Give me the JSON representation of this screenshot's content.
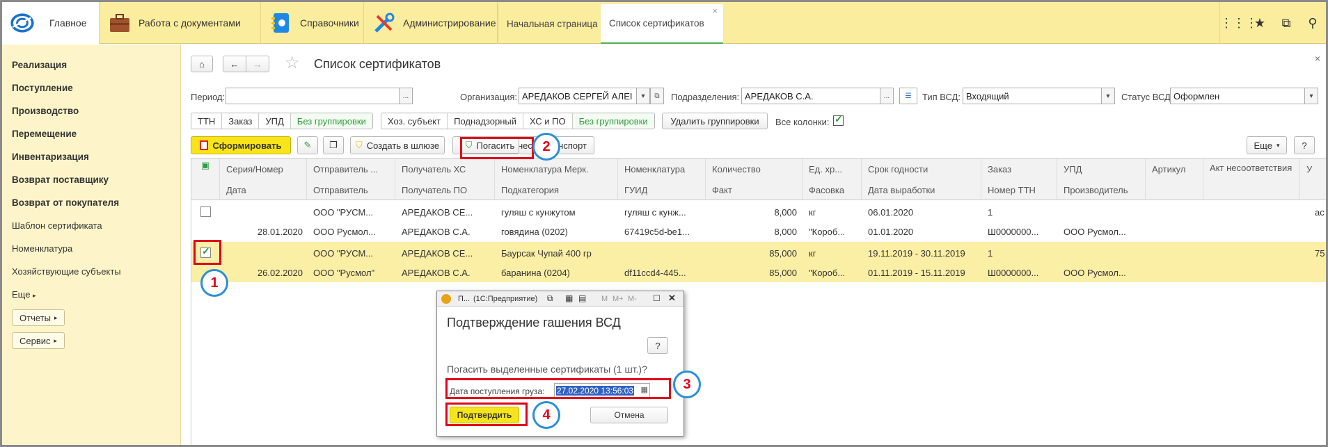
{
  "topbar": {
    "home_label": "Главное",
    "sections": [
      "Работа с документами",
      "Справочники",
      "Администрирование"
    ],
    "tabs": [
      {
        "label": "Начальная страница"
      },
      {
        "label": "Список сертификатов"
      }
    ],
    "tab_close": "×",
    "icons": [
      "apps-grid-icon",
      "star-icon",
      "history-icon",
      "search-icon"
    ]
  },
  "sidebar": {
    "bold_items": [
      "Реализация",
      "Поступление",
      "Производство",
      "Перемещение",
      "Инвентаризация",
      "Возврат поставщику",
      "Возврат от покупателя"
    ],
    "items": [
      "Шаблон сертификата",
      "Номенклатура",
      "Хозяйствующие субъекты"
    ],
    "more": "Еще",
    "reports": "Отчеты",
    "service": "Сервис"
  },
  "main": {
    "title": "Список сертификатов",
    "close": "×",
    "filters": {
      "period_label": "Период:",
      "period_value": "",
      "org_label": "Организация:",
      "org_value": "АРЕДАКОВ СЕРГЕЙ АЛЕІ",
      "dept_label": "Подразделения:",
      "dept_value": "АРЕДАКОВ С.А.",
      "vsd_type_label": "Тип ВСД:",
      "vsd_type_value": "Входящий",
      "vsd_status_label": "Статус ВСД:",
      "vsd_status_value": "Оформлен"
    },
    "grouping1": [
      "ТТН",
      "Заказ",
      "УПД",
      "Без группировки"
    ],
    "grouping2": [
      "Хоз. субъект",
      "Поднадзорный",
      "ХС и ПО",
      "Без группировки"
    ],
    "remove_groupings": "Удалить группировки",
    "all_columns_label": "Все колонки:",
    "toolbar": {
      "form_button": "Сформировать",
      "create_gateway": "Создать в шлюзе",
      "repay": "Погасить",
      "transport": "нести транспорт",
      "more": "Еще",
      "help": "?"
    },
    "columns_top": [
      "Серия/Номер",
      "Отправитель ...",
      "Получатель ХС",
      "Номенклатура Мерк.",
      "Номенклатура",
      "Количество",
      "Ед. хр...",
      "Срок годности",
      "Заказ",
      "УПД",
      "Артикул",
      "Акт несоответствия",
      "У"
    ],
    "columns_bottom": [
      "Дата",
      "Отправитель",
      "Получатель ПО",
      "Подкатегория",
      "ГУИД",
      "Факт",
      "Фасовка",
      "Дата выработки",
      "Номер ТТН",
      "Производитель"
    ],
    "rows": [
      {
        "checked": false,
        "line1": {
          "sender": "ООО \"РУСМ...",
          "receiver": "АРЕДАКОВ СЕ...",
          "nom_merc": "гуляш с кунжутом",
          "nom": "гуляш с кунж...",
          "qty": "8,000",
          "unit": "кг",
          "expiry": "06.01.2020",
          "order": "1",
          "extra": "ас"
        },
        "line2": {
          "date": "28.01.2020",
          "sender": "ООО Русмол...",
          "receiver": "АРЕДАКОВ С.А.",
          "subcat": "говядина (0202)",
          "guid": "67419c5d-be1...",
          "fact": "8,000",
          "pack": "\"Короб...",
          "prod_date": "01.01.2020",
          "ttn": "Ш0000000...",
          "producer": "ООО Русмол..."
        }
      },
      {
        "checked": true,
        "line1": {
          "sender": "ООО \"РУСМ...",
          "receiver": "АРЕДАКОВ СЕ...",
          "nom_merc": "Баурсак Чупай 400 гр",
          "nom": "",
          "qty": "85,000",
          "unit": "кг",
          "expiry": "19.11.2019 - 30.11.2019",
          "order": "1",
          "extra": "75"
        },
        "line2": {
          "date": "26.02.2020",
          "sender": "ООО \"Русмол\"",
          "receiver": "АРЕДАКОВ С.А.",
          "subcat": "баранина (0204)",
          "guid": "df11ccd4-445...",
          "fact": "85,000",
          "pack": "\"Короб...",
          "prod_date": "01.11.2019 - 15.11.2019",
          "ttn": "Ш0000000...",
          "producer": "ООО Русмол..."
        }
      }
    ]
  },
  "dialog": {
    "title_short": "П...",
    "title_app": "(1С:Предприятие)",
    "title_letters": [
      "M",
      "M+",
      "M-"
    ],
    "heading": "Подтверждение гашения ВСД",
    "help": "?",
    "question": "Погасить выделенные сертификаты (1 шт.)?",
    "date_label": "Дата поступления груза:",
    "date_value": "27.02.2020 13:56:03",
    "confirm": "Подтвердить",
    "cancel": "Отмена"
  },
  "callouts": [
    "1",
    "2",
    "3",
    "4"
  ],
  "colors": {
    "accent_yellow": "#fbed9e",
    "green": "#2e9c3a",
    "callout_red": "#e0001b",
    "callout_blue": "#2b8fd6"
  }
}
